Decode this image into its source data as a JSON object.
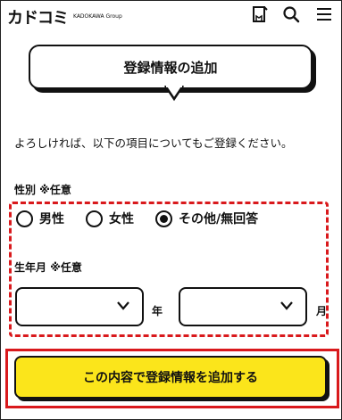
{
  "header": {
    "logo_text": "カドコミ",
    "logo_sub": "KADOKAWA Group",
    "icons": [
      "bookshelf-icon",
      "search-icon",
      "menu-icon"
    ]
  },
  "dialog": {
    "title": "登録情報の追加",
    "intro": "よろしければ、以下の項目についてもご登録ください。"
  },
  "gender": {
    "label": "性別 ※任意",
    "options": [
      {
        "label": "男性",
        "selected": false
      },
      {
        "label": "女性",
        "selected": false
      },
      {
        "label": "その他/無回答",
        "selected": true
      }
    ]
  },
  "birth": {
    "label": "生年月 ※任意",
    "year_unit": "年",
    "month_unit": "月",
    "year_value": "",
    "month_value": ""
  },
  "submit_label": "この内容で登録情報を追加する",
  "colors": {
    "accent_yellow": "#fbe51b",
    "highlight_red": "#d9191c"
  }
}
